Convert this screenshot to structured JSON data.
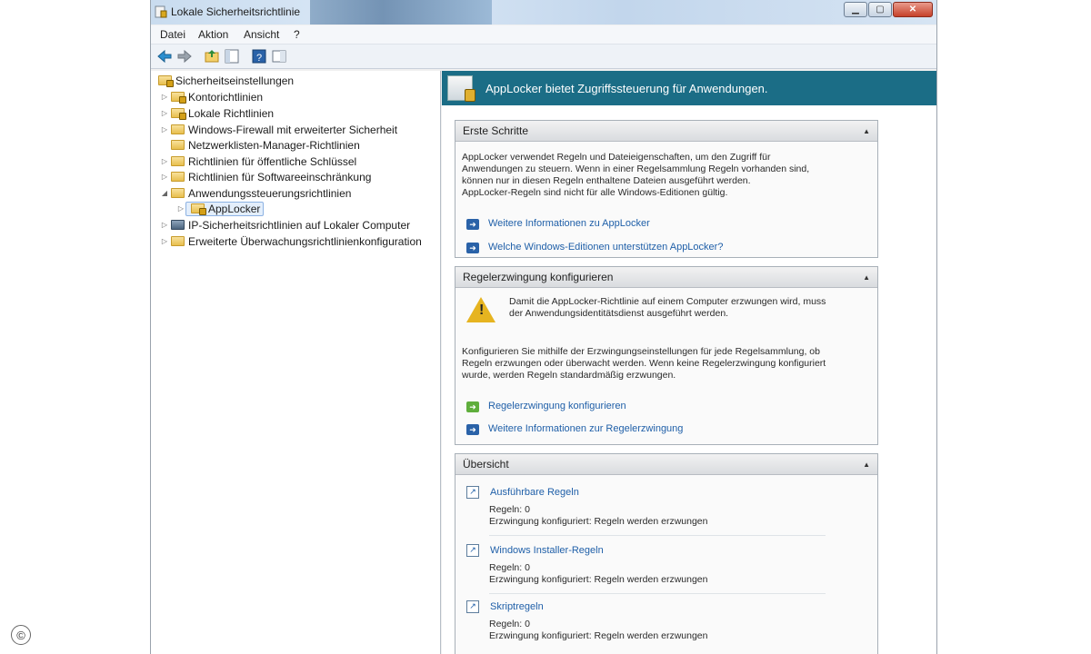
{
  "window": {
    "title": "Lokale Sicherheitsrichtlinie"
  },
  "menu": [
    "Datei",
    "Aktion",
    "Ansicht",
    "?"
  ],
  "tree": {
    "root": "Sicherheitseinstellungen",
    "items": [
      "Kontorichtlinien",
      "Lokale Richtlinien",
      "Windows-Firewall mit erweiterter Sicherheit",
      "Netzwerklisten-Manager-Richtlinien",
      "Richtlinien für öffentliche Schlüssel",
      "Richtlinien für Softwareeinschränkung",
      "Anwendungssteuerungsrichtlinien",
      "AppLocker",
      "IP-Sicherheitsrichtlinien auf Lokaler Computer",
      "Erweiterte Überwachungsrichtlinienkonfiguration"
    ]
  },
  "header": {
    "text": "AppLocker bietet Zugriffssteuerung für Anwendungen."
  },
  "panels": {
    "erste_schritte": {
      "title": "Erste Schritte",
      "lines": [
        "AppLocker verwendet Regeln und Dateieigenschaften, um den Zugriff für",
        "Anwendungen zu steuern. Wenn in einer Regelsammlung Regeln vorhanden sind,",
        "können nur in diesen Regeln enthaltene Dateien ausgeführt werden.",
        "AppLocker-Regeln sind nicht für alle Windows-Editionen gültig."
      ],
      "link1": "Weitere Informationen zu AppLocker",
      "link2": "Welche Windows-Editionen unterstützen AppLocker?"
    },
    "regelerzwingung": {
      "title": "Regelerzwingung konfigurieren",
      "warn_lines": [
        "Damit die AppLocker-Richtlinie auf einem Computer erzwungen wird, muss",
        "der Anwendungsidentitätsdienst ausgeführt werden."
      ],
      "lines": [
        "Konfigurieren Sie mithilfe der Erzwingungseinstellungen für jede Regelsammlung, ob",
        "Regeln erzwungen oder überwacht werden. Wenn keine Regelerzwingung konfiguriert",
        "wurde, werden Regeln standardmäßig erzwungen."
      ],
      "link1": "Regelerzwingung konfigurieren",
      "link2": "Weitere Informationen zur Regelerzwingung"
    },
    "uebersicht": {
      "title": "Übersicht",
      "rules": [
        {
          "name": "Ausführbare Regeln",
          "count": "Regeln: 0",
          "status": "Erzwingung konfiguriert: Regeln werden erzwungen"
        },
        {
          "name": "Windows Installer-Regeln",
          "count": "Regeln: 0",
          "status": "Erzwingung konfiguriert: Regeln werden erzwungen"
        },
        {
          "name": "Skriptregeln",
          "count": "Regeln: 0",
          "status": "Erzwingung konfiguriert: Regeln werden erzwungen"
        }
      ]
    }
  },
  "copyright": "©"
}
